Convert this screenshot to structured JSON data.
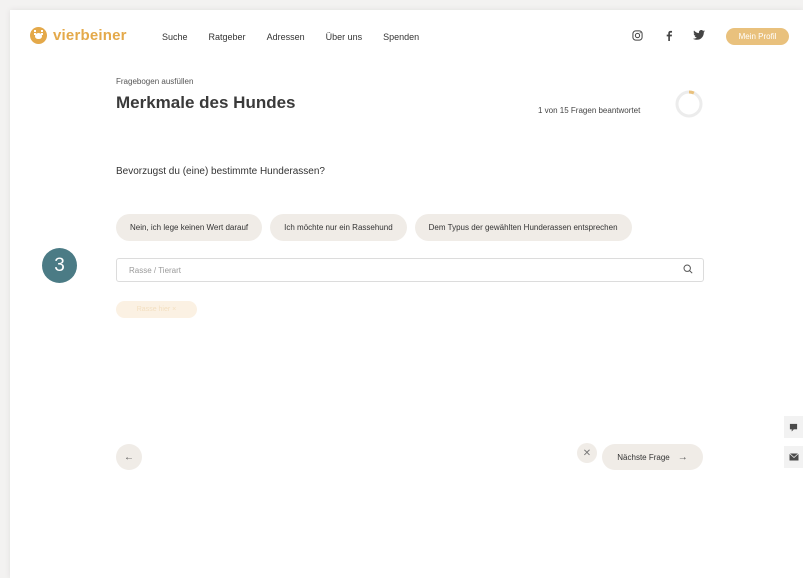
{
  "brand": {
    "name": "vierbeiner",
    "accent": "#e4a94a"
  },
  "nav": {
    "items": [
      "Suche",
      "Ratgeber",
      "Adressen",
      "Über uns",
      "Spenden"
    ],
    "profile_label": "Mein Profil",
    "social_icons": [
      "instagram-icon",
      "facebook-icon",
      "twitter-icon"
    ]
  },
  "questionnaire": {
    "eyebrow": "Fragebogen ausfüllen",
    "title": "Merkmale des Hundes",
    "progress_text": "1 von 15 Fragen beantwortet",
    "progress_fraction": 0.0667,
    "question": "Bevorzugst du (eine) bestimmte Hunderassen?",
    "options": [
      "Nein, ich lege keinen Wert darauf",
      "Ich möchte nur ein Rassehund",
      "Dem Typus der gewählten Hunderassen entsprechen"
    ],
    "search_placeholder": "Rasse / Tierart",
    "selected_tag": "Rasse hier ×",
    "next_label": "Nächste Frage"
  },
  "step_badge": "3",
  "colors": {
    "chip_bg": "#f0ece7",
    "profile_button": "#e9c17d",
    "step_badge": "#4b7b85"
  }
}
